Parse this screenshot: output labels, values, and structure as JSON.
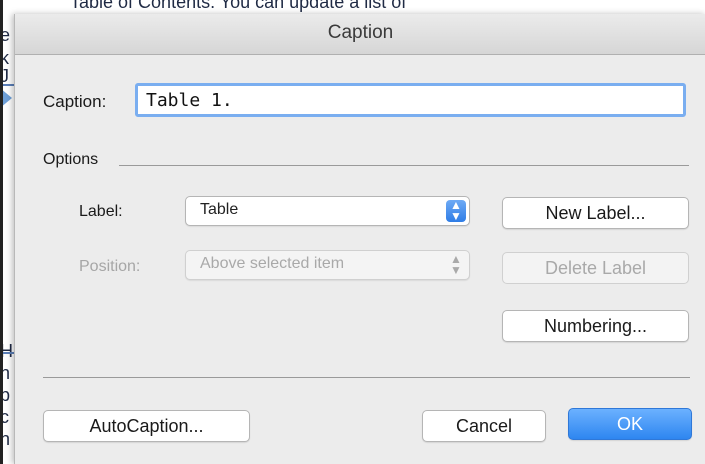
{
  "background_doc": {
    "top_line": "Table of Contents. You can update a list of",
    "left_letters": [
      "e",
      "k",
      "J",
      "H",
      "n",
      "p",
      "c",
      "n"
    ]
  },
  "dialog": {
    "title": "Caption",
    "caption_label": "Caption:",
    "caption_value": "Table 1.",
    "options_label": "Options",
    "label_row": {
      "label": "Label:",
      "value": "Table"
    },
    "position_row": {
      "label": "Position:",
      "value": "Above selected item"
    },
    "buttons": {
      "new_label": "New Label...",
      "delete_label": "Delete Label",
      "numbering": "Numbering...",
      "autocaption": "AutoCaption...",
      "cancel": "Cancel",
      "ok": "OK"
    },
    "colors": {
      "accent": "#2e86f0",
      "focus_ring": "#7aaef0",
      "dialog_bg": "#ececec"
    }
  }
}
